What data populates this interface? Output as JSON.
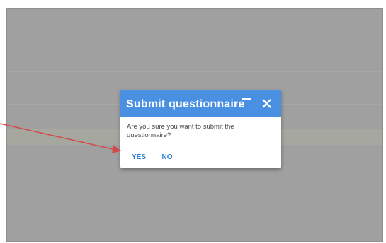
{
  "dialog": {
    "title": "Submit questionnaire",
    "message": "Are you sure you want to submit the questionnaire?",
    "yes_label": "YES",
    "no_label": "NO",
    "minimize_icon": "minimize-icon",
    "close_icon": "close-icon"
  },
  "colors": {
    "header": "#4a90e2",
    "overlay": "#a0a0a0",
    "action_text": "#2f7fd8",
    "annotation_arrow": "#d24a4a"
  }
}
